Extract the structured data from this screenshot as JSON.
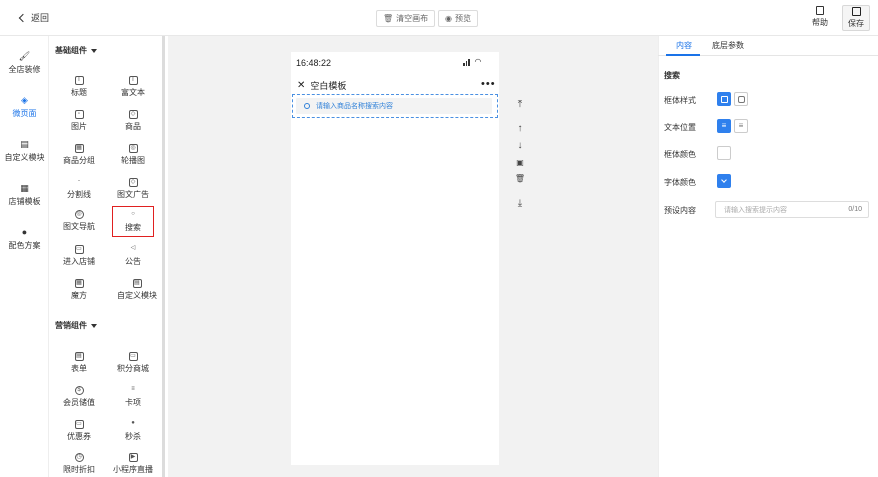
{
  "topbar": {
    "back_label": "返回",
    "clear_label": "清空画布",
    "preview_label": "预览",
    "help_label": "帮助",
    "save_label": "保存"
  },
  "leftnav": {
    "items": [
      {
        "label": "全店装修",
        "icon": "paint-roller-icon"
      },
      {
        "label": "微页面",
        "icon": "layers-icon",
        "active": true
      },
      {
        "label": "自定义模块",
        "icon": "module-icon"
      },
      {
        "label": "店铺模板",
        "icon": "template-icon"
      },
      {
        "label": "配色方案",
        "icon": "palette-icon"
      }
    ]
  },
  "components": {
    "basic_title": "基础组件",
    "basic": [
      {
        "label": "标题",
        "glyph": "T"
      },
      {
        "label": "富文本",
        "glyph": "T"
      },
      {
        "label": "图片",
        "glyph": "▫"
      },
      {
        "label": "商品",
        "glyph": "◇"
      },
      {
        "label": "商品分组",
        "glyph": "▦"
      },
      {
        "label": "轮播图",
        "glyph": "◎"
      },
      {
        "label": "分割线",
        "glyph": "-"
      },
      {
        "label": "图文广告",
        "glyph": "◇"
      },
      {
        "label": "图文导航",
        "glyph": "◎"
      },
      {
        "label": "搜索",
        "glyph": "○",
        "selected": true
      },
      {
        "label": "进入店铺",
        "glyph": "▭"
      },
      {
        "label": "公告",
        "glyph": "◁"
      },
      {
        "label": "魔方",
        "glyph": "▦"
      },
      {
        "label": "自定义模块",
        "glyph": "▤"
      }
    ],
    "marketing_title": "营销组件",
    "marketing": [
      {
        "label": "表单",
        "glyph": "▤"
      },
      {
        "label": "积分商城",
        "glyph": "▭"
      },
      {
        "label": "会员储值",
        "glyph": "$"
      },
      {
        "label": "卡项",
        "glyph": "≡"
      },
      {
        "label": "优惠券",
        "glyph": "▭"
      },
      {
        "label": "秒杀",
        "glyph": "●"
      },
      {
        "label": "限时折扣",
        "glyph": "◷"
      },
      {
        "label": "小程序直播",
        "glyph": "▶"
      }
    ]
  },
  "phone": {
    "time": "16:48:22",
    "title": "空白模板",
    "more": "•••",
    "search_placeholder": "请输入商品名称搜索内容"
  },
  "settings": {
    "tab_content": "内容",
    "tab_layer": "底层参数",
    "section": "搜索",
    "frame_style_label": "框体样式",
    "text_position_label": "文本位置",
    "frame_color_label": "框体颜色",
    "font_color_label": "字体颜色",
    "preset_label": "预设内容",
    "preset_placeholder": "请输入搜索提示内容",
    "preset_counter": "0/10",
    "accent_color": "#2f80ed"
  }
}
